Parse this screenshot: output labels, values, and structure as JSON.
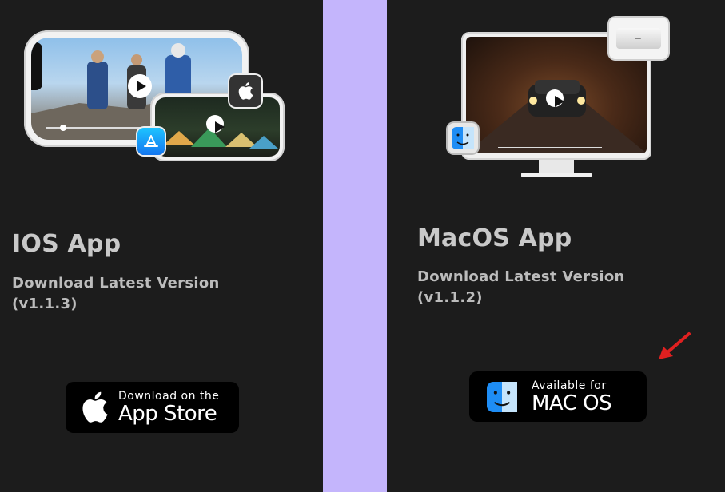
{
  "ios": {
    "title": "IOS App",
    "download_line": "Download Latest Version",
    "version": "(v1.1.3)",
    "button": {
      "line1": "Download on the",
      "line2": "App Store"
    }
  },
  "mac": {
    "title": "MacOS App",
    "download_line": "Download Latest Version",
    "version": "(v1.1.2)",
    "button": {
      "line1": "Available for",
      "line2": "MAC OS"
    }
  },
  "colors": {
    "divider": "#c4b5fc",
    "background": "#1c1c1c",
    "arrow": "#e02020"
  },
  "icons": [
    "apple-logo-icon",
    "app-store-icon",
    "finder-icon",
    "mac-mini-icon",
    "play-icon",
    "red-arrow-icon"
  ]
}
